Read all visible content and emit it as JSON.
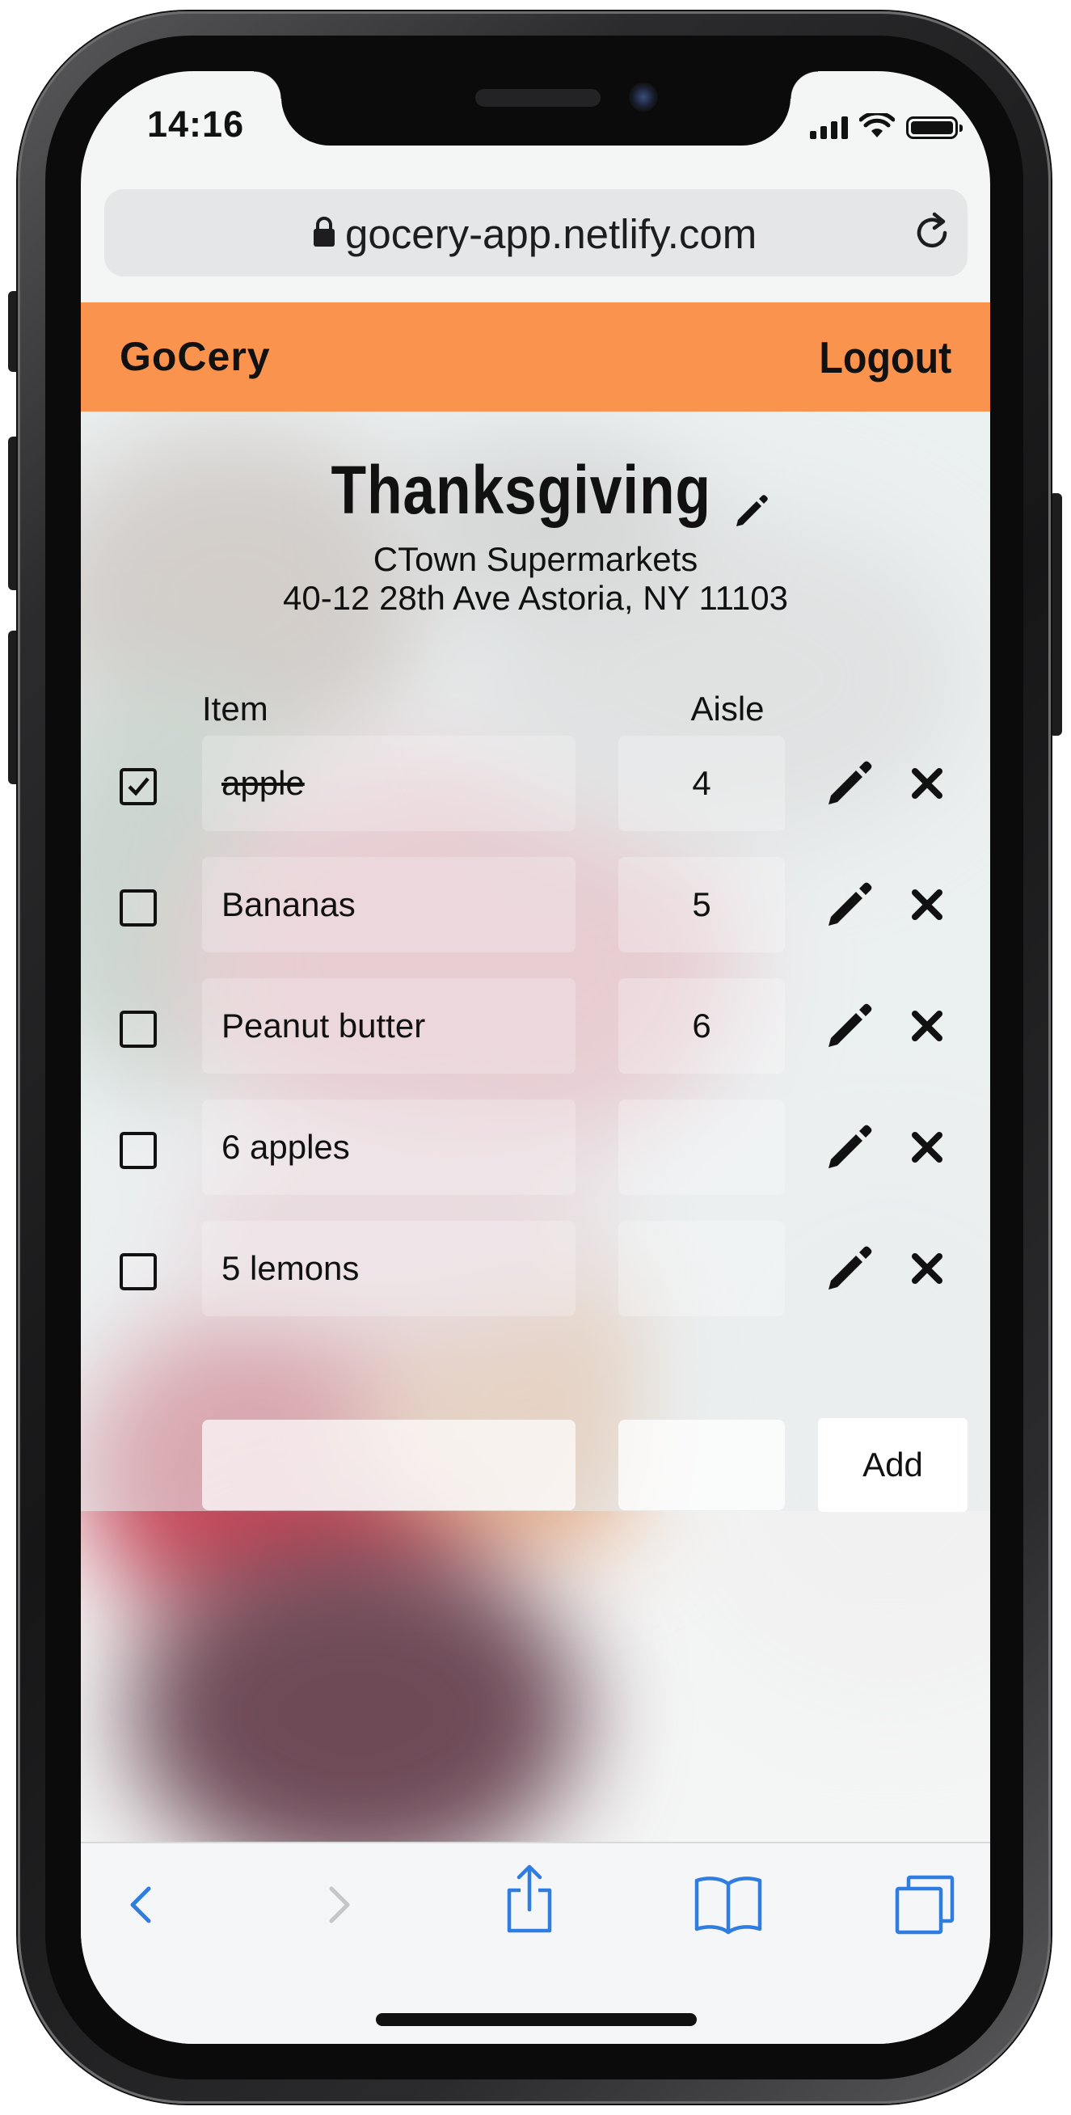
{
  "status_bar": {
    "time": "14:16"
  },
  "browser": {
    "url": "gocery-app.netlify.com"
  },
  "app_header": {
    "brand": "GoCery",
    "logout_label": "Logout"
  },
  "list": {
    "title": "Thanksgiving",
    "store_name": "CTown Supermarkets",
    "store_address": "40-12 28th Ave Astoria, NY 11103",
    "columns": {
      "item": "Item",
      "aisle": "Aisle"
    },
    "items": [
      {
        "name": "apple",
        "aisle": "4",
        "checked": true
      },
      {
        "name": "Bananas",
        "aisle": "5",
        "checked": false
      },
      {
        "name": "Peanut butter",
        "aisle": "6",
        "checked": false
      },
      {
        "name": "6 apples",
        "aisle": "",
        "checked": false
      },
      {
        "name": "5 lemons",
        "aisle": "",
        "checked": false
      }
    ]
  },
  "add_form": {
    "item_value": "",
    "aisle_value": "",
    "add_label": "Add"
  },
  "colors": {
    "header_bg": "#f9934e",
    "toolbar_icon_active": "#2f7de1",
    "toolbar_icon_disabled": "#c4c6ca"
  },
  "toolbar": {
    "icons": [
      "back-icon",
      "forward-icon",
      "share-icon",
      "bookmarks-icon",
      "tabs-icon"
    ]
  }
}
